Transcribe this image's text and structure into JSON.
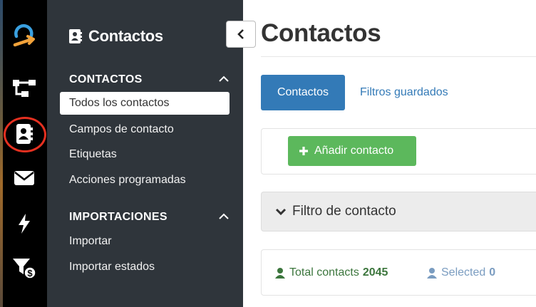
{
  "sidebar": {
    "title": "Contactos",
    "sections": [
      {
        "label": "CONTACTOS",
        "items": [
          "Todos los contactos",
          "Campos de contacto",
          "Etiquetas",
          "Acciones programadas"
        ]
      },
      {
        "label": "IMPORTACIONES",
        "items": [
          "Importar",
          "Importar estados"
        ]
      }
    ],
    "active_item": "Todos los contactos"
  },
  "rail": {
    "icons": [
      "logo-icon",
      "workflow-icon",
      "contacts-icon",
      "mail-icon",
      "lightning-icon",
      "funnel-dollar-icon"
    ],
    "highlighted": "contacts-icon",
    "highlight_color": "#e53020"
  },
  "main": {
    "title": "Contactos",
    "tabs": [
      "Contactos",
      "Filtros guardados"
    ],
    "add_button": "Añadir contacto",
    "filter_label": "Filtro de contacto",
    "total_label": "Total contacts",
    "total_value": "2045",
    "selected_label": "Selected",
    "selected_value": "0"
  },
  "colors": {
    "primary": "#337ab7",
    "success": "#5cb85c",
    "sidebar_bg": "#2f353b",
    "rail_bg": "#000000"
  }
}
